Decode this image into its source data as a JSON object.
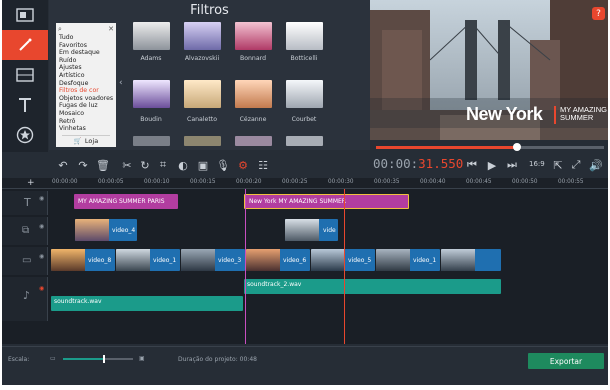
{
  "filters": {
    "title": "Filtros",
    "categories": [
      "Tudo",
      "Favoritos",
      "Em destaque",
      "Ruído",
      "Ajustes",
      "Artístico",
      "Desfoque",
      "Filtros de cor",
      "Objetos voadores",
      "Fugas de luz",
      "Mosaico",
      "Retrô",
      "Vinhetas"
    ],
    "selected_category": "Filtros de cor",
    "store_label": "Loja",
    "items": [
      {
        "name": "Adams",
        "color": "#9aa0a8"
      },
      {
        "name": "Alvazovskii",
        "color": "#6e6aa8"
      },
      {
        "name": "Bonnard",
        "color": "#b03a66"
      },
      {
        "name": "Botticelli",
        "color": "#b7bcc4"
      },
      {
        "name": "Boudin",
        "color": "#6b4e9a"
      },
      {
        "name": "Canaletto",
        "color": "#c7a878"
      },
      {
        "name": "Cézanne",
        "color": "#c27a4e"
      },
      {
        "name": "Courbet",
        "color": "#9ea6b0"
      }
    ]
  },
  "preview": {
    "title_text": "New York",
    "subtitle_text": "MY AMAZING SUMMER",
    "progress": 0.62
  },
  "player": {
    "time_dim": "00:00:",
    "time_hl": "31.550",
    "aspect": "16:9"
  },
  "ruler": [
    "00:00:00",
    "00:00:05",
    "00:00:10",
    "00:00:15",
    "00:00:20",
    "00:00:25",
    "00:00:30",
    "00:00:35",
    "00:00:40",
    "00:00:45",
    "00:00:50",
    "00:00:55"
  ],
  "timeline": {
    "text_clips": [
      "MY AMAZING SUMMER PARIS",
      "New York MY AMAZING SUMMER"
    ],
    "overlay_clips": [
      "video_4",
      "vide"
    ],
    "video_clips": [
      "video_8",
      "video_1",
      "video_3",
      "video_6",
      "video_5",
      "video_1"
    ],
    "audio_clips": [
      "soundtrack_2.wav",
      "soundtrack.wav"
    ]
  },
  "bottom": {
    "scale_label": "Escala:",
    "duration_label": "Duração do projeto:",
    "duration_value": "00:48",
    "export_label": "Exportar"
  },
  "colors": {
    "accent": "#e8472e",
    "text_clip": "#b23da0",
    "video_clip": "#1f6fb0",
    "audio_clip": "#1b9b8a",
    "export": "#1e8a5e"
  }
}
